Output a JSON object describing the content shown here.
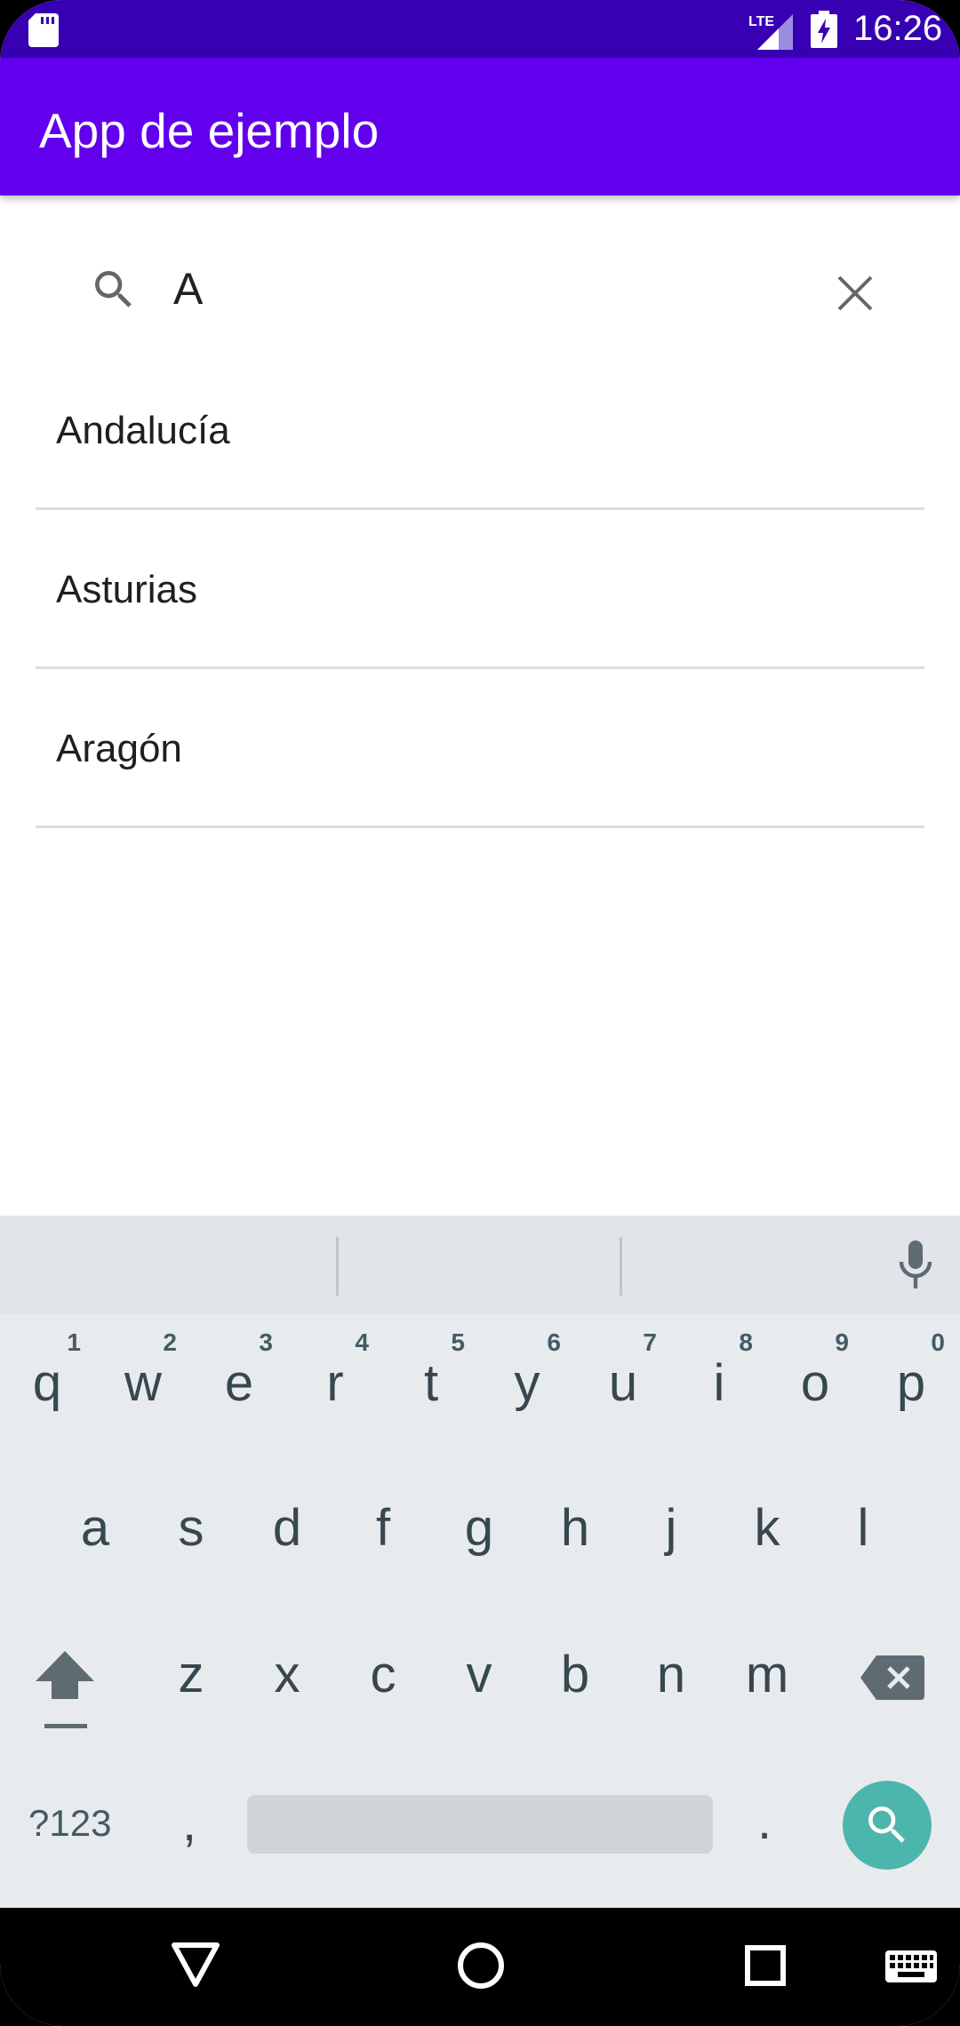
{
  "status_bar": {
    "time": "16:26",
    "network_label": "LTE",
    "icons": [
      "sd-card-icon",
      "signal-icon",
      "battery-charging-icon"
    ]
  },
  "app_bar": {
    "title": "App de ejemplo"
  },
  "search": {
    "value": "A",
    "icons": [
      "search-icon",
      "close-icon"
    ]
  },
  "results": [
    {
      "label": "Andalucía"
    },
    {
      "label": "Asturias"
    },
    {
      "label": "Aragón"
    }
  ],
  "keyboard": {
    "row1": [
      {
        "key": "q",
        "alt": "1"
      },
      {
        "key": "w",
        "alt": "2"
      },
      {
        "key": "e",
        "alt": "3"
      },
      {
        "key": "r",
        "alt": "4"
      },
      {
        "key": "t",
        "alt": "5"
      },
      {
        "key": "y",
        "alt": "6"
      },
      {
        "key": "u",
        "alt": "7"
      },
      {
        "key": "i",
        "alt": "8"
      },
      {
        "key": "o",
        "alt": "9"
      },
      {
        "key": "p",
        "alt": "0"
      }
    ],
    "row2": [
      "a",
      "s",
      "d",
      "f",
      "g",
      "h",
      "j",
      "k",
      "l"
    ],
    "row3": [
      "z",
      "x",
      "c",
      "v",
      "b",
      "n",
      "m"
    ],
    "symbols_label": "?123",
    "comma_label": ",",
    "period_label": ".",
    "icons": [
      "mic-icon",
      "shift-icon",
      "backspace-icon",
      "search-action-icon"
    ],
    "accent_color": "#4db6ac"
  },
  "nav_bar": {
    "icons": [
      "back-icon",
      "home-icon",
      "recents-icon",
      "keyboard-switch-icon"
    ]
  },
  "colors": {
    "status_bar": "#3700b3",
    "app_bar": "#6200ee"
  }
}
